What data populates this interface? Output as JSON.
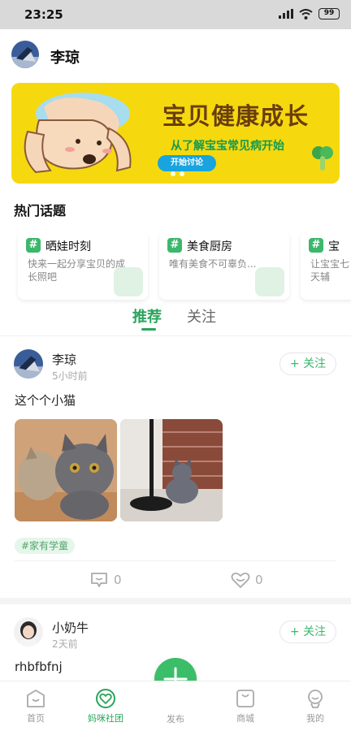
{
  "status_bar": {
    "time": "23:25",
    "battery": "99"
  },
  "header": {
    "username": "李琼"
  },
  "banner": {
    "title": "宝贝健康成长",
    "subtitle": "从了解宝宝常见病开始",
    "cta": "开始讨论",
    "slide_count": 2
  },
  "hot_topics": {
    "title": "热门话题",
    "items": [
      {
        "name": "晒娃时刻",
        "desc": "快来一起分享宝贝的成长照吧"
      },
      {
        "name": "美食厨房",
        "desc": "唯有美食不可辜负..."
      },
      {
        "name": "宝",
        "desc": "让宝宝七天辅"
      }
    ]
  },
  "tabs": [
    {
      "label": "推荐",
      "active": true
    },
    {
      "label": "关注",
      "active": false
    }
  ],
  "posts": [
    {
      "user": "李琼",
      "time": "5小时前",
      "follow_label": "+ 关注",
      "text": "这个个小猫",
      "tag": "#家有学童",
      "comments": "0",
      "likes": "0"
    },
    {
      "user": "小奶牛",
      "time": "2天前",
      "follow_label": "+ 关注",
      "text": "rhbfbfnj"
    }
  ],
  "nav": {
    "items": [
      {
        "label": "首页",
        "icon": "home-icon"
      },
      {
        "label": "妈咪社团",
        "icon": "heart-chat-icon",
        "active": true
      },
      {
        "label": "发布",
        "icon": "plus-icon"
      },
      {
        "label": "商城",
        "icon": "bag-icon"
      },
      {
        "label": "我的",
        "icon": "profile-icon"
      }
    ]
  },
  "colors": {
    "accent": "#2aa45b",
    "banner_bg": "#f5d90e",
    "cta": "#18a4df"
  }
}
